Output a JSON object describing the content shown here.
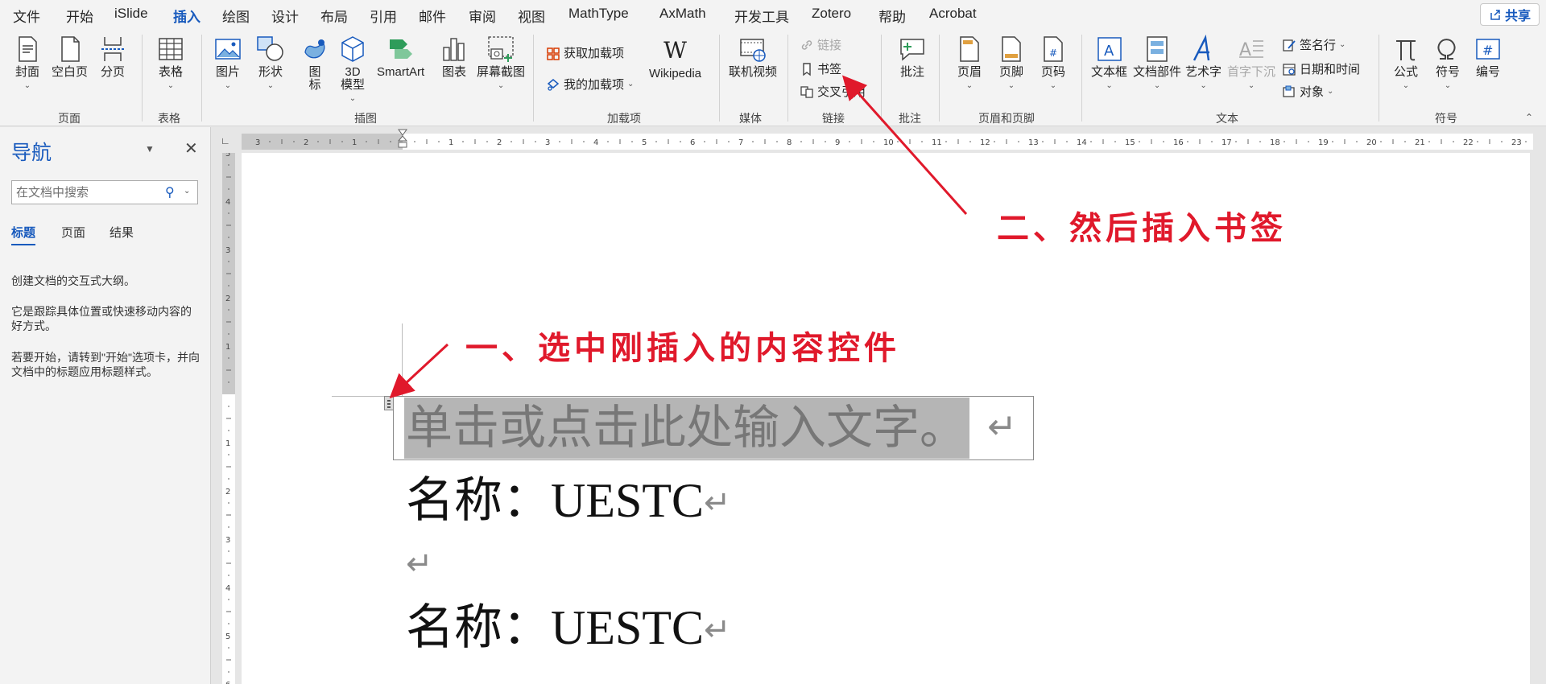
{
  "menu": {
    "tabs": [
      "文件",
      "开始",
      "iSlide",
      "插入",
      "绘图",
      "设计",
      "布局",
      "引用",
      "邮件",
      "审阅",
      "视图",
      "MathType",
      "AxMath",
      "开发工具",
      "Zotero",
      "帮助",
      "Acrobat"
    ],
    "active_tab": "插入",
    "share_label": "共享"
  },
  "ribbon": {
    "pages": {
      "cover": "封面",
      "blank": "空白页",
      "break": "分页",
      "group": "页面"
    },
    "tables": {
      "table": "表格",
      "group": "表格"
    },
    "illustrations": {
      "picture": "图片",
      "shapes": "形状",
      "icons": "图\n标",
      "model3d": "3D\n模型",
      "smartart": "SmartArt",
      "chart": "图表",
      "screenshot": "屏幕截图",
      "group": "插图"
    },
    "addins": {
      "get": "获取加载项",
      "mine": "我的加载项",
      "wikipedia": "Wikipedia",
      "group": "加载项"
    },
    "media": {
      "video": "联机视频",
      "group": "媒体"
    },
    "links": {
      "link": "链接",
      "bookmark": "书签",
      "crossref": "交叉引用",
      "group": "链接"
    },
    "comments": {
      "comment": "批注",
      "group": "批注"
    },
    "header_footer": {
      "header": "页眉",
      "footer": "页脚",
      "page_number": "页码",
      "group": "页眉和页脚"
    },
    "text": {
      "textbox": "文本框",
      "quickparts": "文档部件",
      "wordart": "艺术字",
      "dropcap": "首字下沉",
      "signature": "签名行",
      "datetime": "日期和时间",
      "object": "对象",
      "group": "文本"
    },
    "symbols": {
      "equation": "公式",
      "symbol": "符号",
      "number": "编号",
      "group": "符号"
    }
  },
  "nav": {
    "title": "导航",
    "search_placeholder": "在文档中搜索",
    "tabs": [
      "标题",
      "页面",
      "结果"
    ],
    "active_tab": "标题",
    "info1": "创建文档的交互式大纲。",
    "info2": "它是跟踪具体位置或快速移动内容的好方式。",
    "info3": "若要开始，请转到\"开始\"选项卡，并向文档中的标题应用标题样式。"
  },
  "document": {
    "placeholder_text": "单击或点击此处输入文字。",
    "line1": "名称：UESTC",
    "line3": "名称：UESTC",
    "paragraph_mark": "↵"
  },
  "annotations": {
    "step1": "一、选中刚插入的内容控件",
    "step2": "二、然后插入书签",
    "color": "#e0192b"
  },
  "colors": {
    "accent": "#185abd",
    "annotation": "#e0192b"
  }
}
